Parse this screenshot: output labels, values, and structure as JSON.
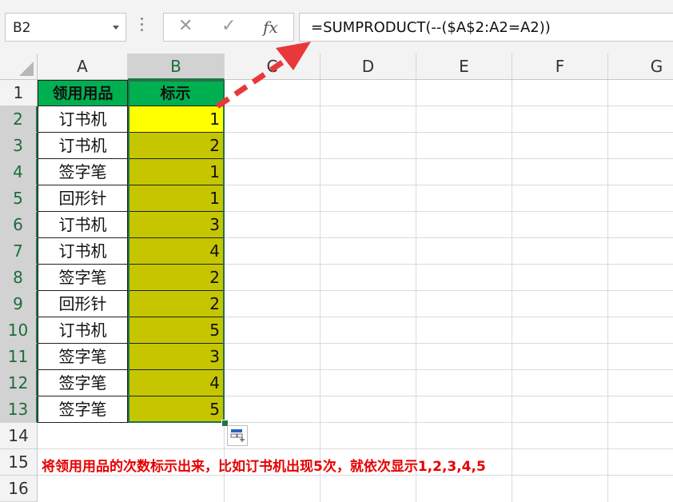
{
  "formula_bar": {
    "name_box": "B2",
    "cancel_icon": "✕",
    "enter_icon": "✓",
    "fx_label": "fx",
    "formula": "=SUMPRODUCT(--($A$2:A2=A2))"
  },
  "columns": [
    "A",
    "B",
    "C",
    "D",
    "E",
    "F",
    "G"
  ],
  "rows": [
    "1",
    "2",
    "3",
    "4",
    "5",
    "6",
    "7",
    "8",
    "9",
    "10",
    "11",
    "12",
    "13",
    "14",
    "15",
    "16"
  ],
  "header": {
    "col_a": "领用用品",
    "col_b": "标示"
  },
  "data_rows": [
    {
      "item": "订书机",
      "mark": "1"
    },
    {
      "item": "订书机",
      "mark": "2"
    },
    {
      "item": "签字笔",
      "mark": "1"
    },
    {
      "item": "回形针",
      "mark": "1"
    },
    {
      "item": "订书机",
      "mark": "3"
    },
    {
      "item": "订书机",
      "mark": "4"
    },
    {
      "item": "签字笔",
      "mark": "2"
    },
    {
      "item": "回形针",
      "mark": "2"
    },
    {
      "item": "订书机",
      "mark": "5"
    },
    {
      "item": "签字笔",
      "mark": "3"
    },
    {
      "item": "签字笔",
      "mark": "4"
    },
    {
      "item": "签字笔",
      "mark": "5"
    }
  ],
  "note": "将领用用品的次数标示出来，比如订书机出现5次，就依次显示1,2,3,4,5",
  "colors": {
    "header_green": "#00b050",
    "selected_yellow": "#ffff00",
    "fill_olive": "#c5c600",
    "note_red": "#e60000",
    "arrow_red": "#e8383a"
  }
}
